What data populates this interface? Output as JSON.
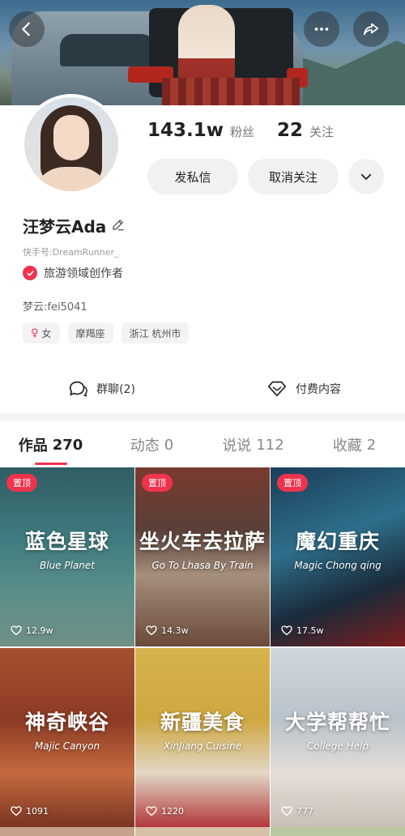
{
  "header": {
    "back_icon": "chevron-left-icon",
    "more_icon": "ellipsis-icon",
    "share_icon": "share-icon"
  },
  "profile": {
    "followers_count": "143.1w",
    "followers_label": "粉丝",
    "following_count": "22",
    "following_label": "关注",
    "message_button": "发私信",
    "unfollow_button": "取消关注",
    "name": "汪梦云Ada",
    "kuaishou_id": "快手号:DreamRunner_",
    "certification": "旅游领域创作者",
    "bio": "梦云:fei5041",
    "tags": [
      "女",
      "摩羯座",
      "浙江 杭州市"
    ]
  },
  "actions": {
    "group_chat": "群聊(2)",
    "paid_content": "付费内容"
  },
  "tabs": [
    {
      "label": "作品",
      "count": "270",
      "active": true
    },
    {
      "label": "动态",
      "count": "0",
      "active": false
    },
    {
      "label": "说说",
      "count": "112",
      "active": false
    },
    {
      "label": "收藏",
      "count": "2",
      "active": false
    }
  ],
  "videos": [
    {
      "pinned": "置顶",
      "title": "蓝色星球",
      "subtitle": "Blue Planet",
      "likes": "12.9w"
    },
    {
      "pinned": "置顶",
      "title": "坐火车去拉萨",
      "subtitle": "Go To Lhasa By Train",
      "likes": "14.3w"
    },
    {
      "pinned": "置顶",
      "title": "魔幻重庆",
      "subtitle": "Magic Chong qing",
      "likes": "17.5w"
    },
    {
      "pinned": "",
      "title": "神奇峡谷",
      "subtitle": "Majic Canyon",
      "likes": "1091"
    },
    {
      "pinned": "",
      "title": "新疆美食",
      "subtitle": "XinJiang Cuisine",
      "likes": "1220"
    },
    {
      "pinned": "",
      "title": "大学帮帮忙",
      "subtitle": "College Help",
      "likes": "777"
    }
  ],
  "colors": {
    "accent": "#f0334d"
  }
}
